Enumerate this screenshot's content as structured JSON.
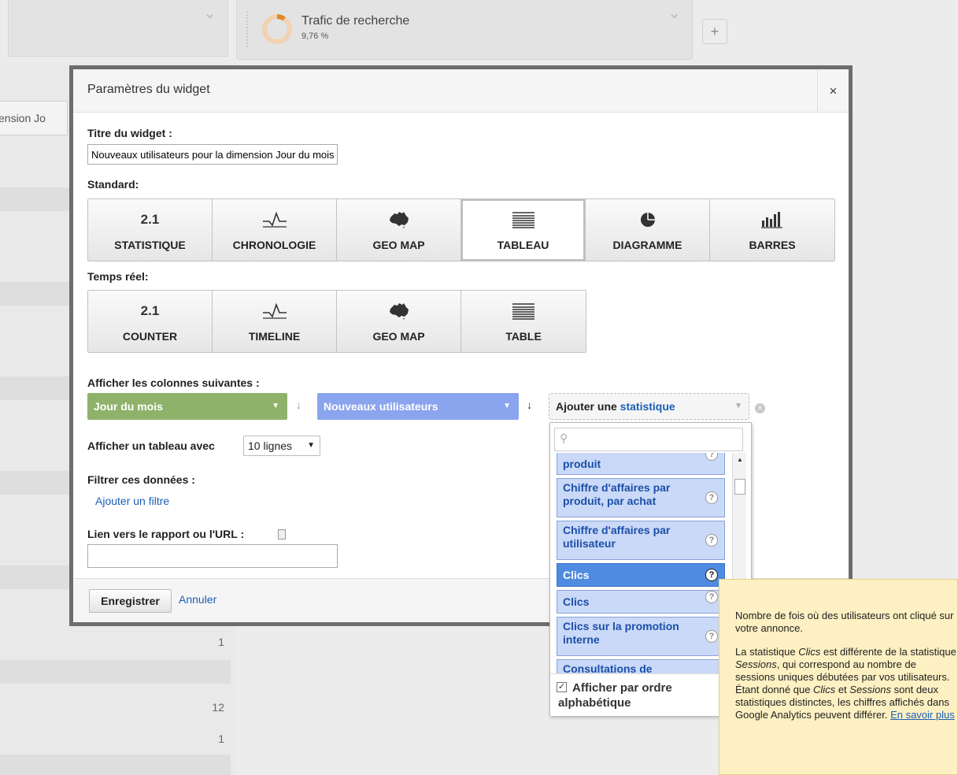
{
  "dashboard": {
    "widget_title": "Trafic de recherche",
    "widget_value": "9,76 %",
    "add_button": "+",
    "column_header": "ension Jo",
    "row_values": [
      "1",
      "12",
      "1"
    ]
  },
  "modal": {
    "title": "Paramètres du widget",
    "close": "×",
    "title_label": "Titre du widget :",
    "title_value": "Nouveaux utilisateurs pour la dimension Jour du mois",
    "standard_label": "Standard:",
    "standard_types": [
      {
        "icon": "2.1",
        "label": "STATISTIQUE"
      },
      {
        "icon": "timeline",
        "label": "CHRONOLOGIE"
      },
      {
        "icon": "geo-map",
        "label": "GEO MAP"
      },
      {
        "icon": "table",
        "label": "TABLEAU"
      },
      {
        "icon": "pie",
        "label": "DIAGRAMME"
      },
      {
        "icon": "bars",
        "label": "BARRES"
      }
    ],
    "selected_standard": "TABLEAU",
    "realtime_label": "Temps réel:",
    "realtime_types": [
      {
        "icon": "2.1",
        "label": "COUNTER"
      },
      {
        "icon": "timeline",
        "label": "TIMELINE"
      },
      {
        "icon": "geo-map",
        "label": "GEO MAP"
      },
      {
        "icon": "table",
        "label": "TABLE"
      }
    ],
    "columns_label": "Afficher les colonnes suivantes :",
    "dimension": "Jour du mois",
    "metric": "Nouveaux utilisateurs",
    "add_metric_prefix": "Ajouter une",
    "add_metric_link": "statistique",
    "rows_label": "Afficher un tableau avec",
    "rows_value": "10 lignes",
    "filter_label": "Filtrer ces données :",
    "add_filter": "Ajouter un filtre",
    "link_label": "Lien vers le rapport ou l'URL :",
    "link_value": "",
    "save": "Enregistrer",
    "cancel": "Annuler"
  },
  "dropdown": {
    "search_placeholder": "",
    "items": [
      "produit",
      "Chiffre d'affaires par produit, par achat",
      "Chiffre d'affaires par utilisateur",
      "Clics",
      "Clics",
      "Clics sur la promotion interne",
      "Consultations de"
    ],
    "hovered_index": 3,
    "sort_checked": true,
    "sort_label": "Afficher par ordre alphabétique"
  },
  "tooltip": {
    "p1": "Nombre de fois où des utilisateurs ont cliqué sur votre annonce.",
    "p2_a": "La statistique ",
    "p2_b": "Clics",
    "p2_c": " est différente de la statistique ",
    "p2_d": "Sessions",
    "p2_e": ", qui correspond au nombre de sessions uniques débutées par vos utilisateurs. Étant donné que ",
    "p2_f": "Clics",
    "p2_g": " et ",
    "p2_h": "Sessions",
    "p2_i": " sont deux statistiques distinctes, les chiffres affichés dans Google Analytics peuvent différer. ",
    "learn_more": "En savoir plus"
  },
  "colors": {
    "dimension_pill": "#8fb26a",
    "metric_pill": "#8aa4ee",
    "item_bg": "#c9d9f7",
    "item_hover": "#4f8be0",
    "tooltip_bg": "#fdf0c2"
  }
}
